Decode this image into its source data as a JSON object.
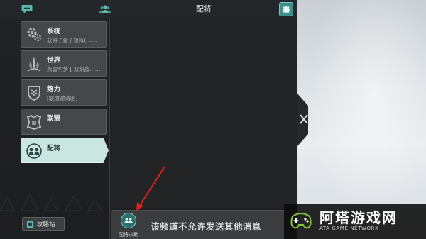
{
  "topbar": {
    "title": "配将",
    "chat_icon": "chat-bubble-icon",
    "group_icon": "group-icon",
    "settings_icon": "gear-icon"
  },
  "channels": [
    {
      "title": "系统",
      "subtitle": "获得了量子矩阵(……",
      "icon": "gear-cluster-icon",
      "selected": false
    },
    {
      "title": "世界",
      "subtitle": "燕雷附梦 [ 双织战……",
      "icon": "world-spire-icon",
      "selected": false
    },
    {
      "title": "势力",
      "subtitle": "[联盟邀请函]",
      "icon": "faction-shield-icon",
      "selected": false
    },
    {
      "title": "联盟",
      "subtitle": "",
      "icon": "alliance-emblem-icon",
      "selected": false
    },
    {
      "title": "配将",
      "subtitle": "",
      "icon": "pairing-icon",
      "selected": true
    }
  ],
  "guide_button": {
    "label": "攻略站"
  },
  "footer": {
    "help_label": "配将求助",
    "notice": "该频道不允许发送其他消息"
  },
  "watermark": {
    "name": "阿塔游戏网",
    "sub": "ATA GAME NETWORK"
  },
  "colors": {
    "accent": "#3d8d8a",
    "selected_channel": "#c9e6e1",
    "annotation_arrow": "#e0201b"
  }
}
